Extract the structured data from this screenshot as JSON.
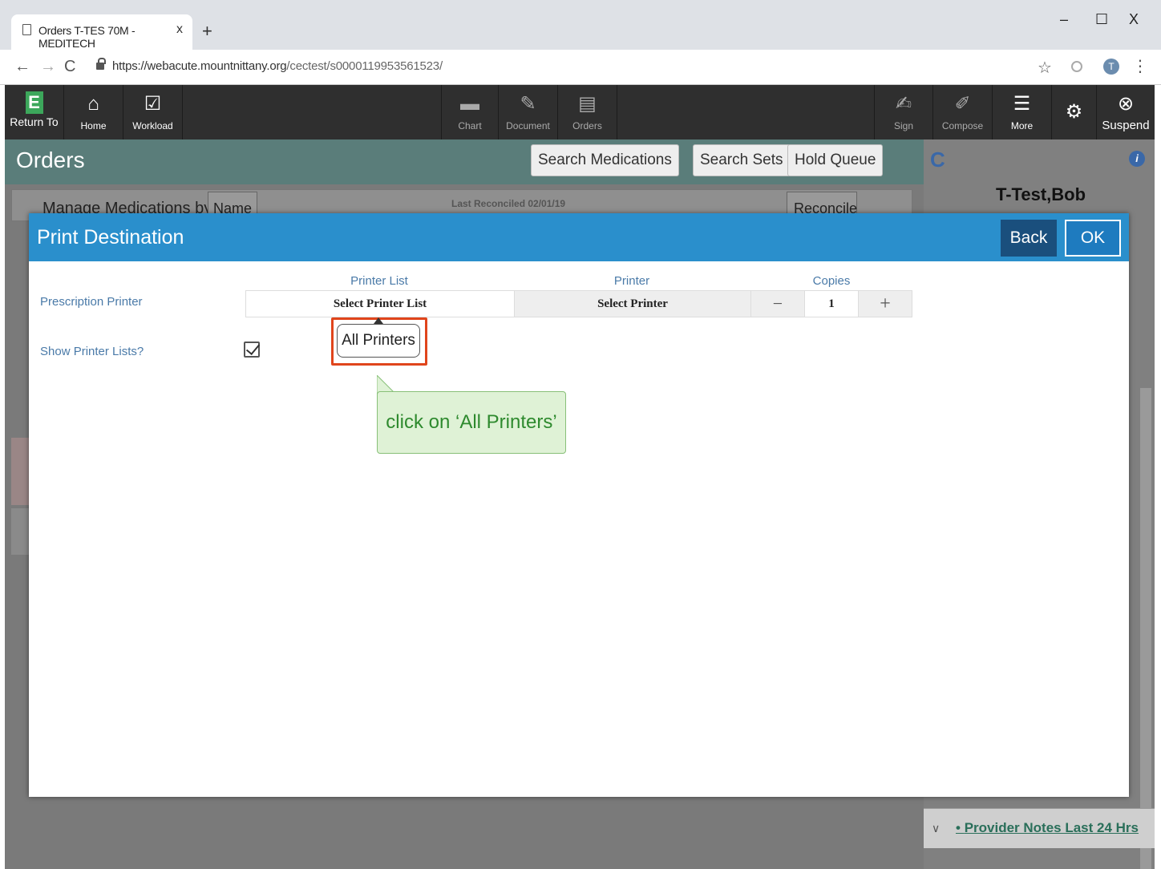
{
  "browser": {
    "tab_title": "Orders T-TES 70M - MEDITECH",
    "tab_close": "x",
    "new_tab": "+",
    "url_base": "https://webacute.mountnittany.org",
    "url_path": "/cectest/s0000119953561523/",
    "window_controls": [
      "–",
      "☐",
      "X"
    ],
    "avatar_letter": "T"
  },
  "toolbar": {
    "return_label": "Return To",
    "logo_letter": "E",
    "home_label": "Home",
    "workload_label": "Workload",
    "chart_label": "Chart",
    "document_label": "Document",
    "orders_label": "Orders",
    "sign_label": "Sign",
    "compose_label": "Compose",
    "more_label": "More",
    "suspend_label": "Suspend"
  },
  "orders": {
    "title": "Orders",
    "search_medications": "Search Medications",
    "search_sets": "Search Sets",
    "hold_queue": "Hold Queue",
    "manage_label": "Manage Medications by",
    "manage_by": "Name",
    "last_reconciled": "Last Reconciled 02/01/19",
    "reconcile": "Reconcile"
  },
  "patient": {
    "name": "T-Test,Bob",
    "notes_link": "Provider Notes Last 24 Hrs"
  },
  "modal": {
    "title": "Print Destination",
    "back": "Back",
    "ok": "OK",
    "prescription_printer_label": "Prescription Printer",
    "show_printer_lists_label": "Show Printer Lists?",
    "col_printer_list": "Printer List",
    "col_printer": "Printer",
    "col_copies": "Copies",
    "printer_list_value": "Select Printer List",
    "printer_value": "Select Printer",
    "copies_minus": "−",
    "copies_value": "1",
    "copies_plus": "+",
    "show_printer_lists_checked": true,
    "dropdown_option": "All Printers"
  },
  "callout": {
    "text": "click on ‘All Printers’"
  },
  "colors": {
    "modal_header": "#2a8fcc",
    "highlight": "#e0451c",
    "callout_bg": "#dff2d6",
    "callout_text": "#2e8a2e"
  }
}
